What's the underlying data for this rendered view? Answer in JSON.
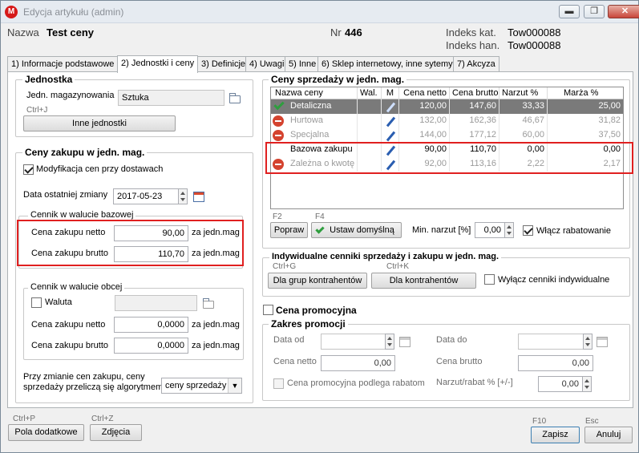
{
  "window": {
    "title": "Edycja artykułu (admin)",
    "minimize": "▬",
    "restore": "❐",
    "close": "✕",
    "app_icon": "M"
  },
  "header": {
    "name_label": "Nazwa",
    "name_value": "Test ceny",
    "nr_label": "Nr",
    "nr_value": "446",
    "indeks_kat_label": "Indeks kat.",
    "indeks_kat_value": "Tow000088",
    "indeks_han_label": "Indeks han.",
    "indeks_han_value": "Tow000088"
  },
  "tabs": [
    {
      "label": "1) Informacje podstawowe"
    },
    {
      "label": "2) Jednostki i ceny",
      "active": true
    },
    {
      "label": "3) Definicje"
    },
    {
      "label": "4) Uwagi"
    },
    {
      "label": "5) Inne"
    },
    {
      "label": "6) Sklep internetowy, inne sytemy"
    },
    {
      "label": "7) Akcyza"
    }
  ],
  "jednostka": {
    "title": "Jednostka",
    "label": "Jedn. magazynowania",
    "value": "Sztuka",
    "hint": "Ctrl+J",
    "other_units_button": "Inne jednostki"
  },
  "ceny_zakupu": {
    "title": "Ceny zakupu w jedn. mag.",
    "modyfikacja_label": "Modyfikacja cen przy dostawach",
    "modyfikacja_checked": true,
    "data_label": "Data ostatniej zmiany",
    "data_value": "2017-05-23",
    "bazowa": {
      "title": "Cennik w walucie bazowej",
      "netto_label": "Cena zakupu netto",
      "netto_value": "90,00",
      "brutto_label": "Cena zakupu brutto",
      "brutto_value": "110,70",
      "unit": "za jedn.mag"
    },
    "obca": {
      "title": "Cennik w walucie obcej",
      "waluta_label": "Waluta",
      "netto_label": "Cena zakupu netto",
      "netto_value": "0,0000",
      "brutto_label": "Cena zakupu brutto",
      "brutto_value": "0,0000",
      "unit": "za jedn.mag"
    },
    "algorytm_label_1": "Przy zmianie cen zakupu, ceny",
    "algorytm_label_2": "sprzedaży przeliczą się algorytmem",
    "algorytm_value": "ceny sprzedaży"
  },
  "ceny_sprzedazy": {
    "title": "Ceny sprzedaży w jedn. mag.",
    "columns": [
      "Nazwa ceny",
      "Wal.",
      "M",
      "Cena netto",
      "Cena brutto",
      "Narzut %",
      "Marża %"
    ],
    "rows": [
      {
        "icon": "check-icon",
        "name": "Detaliczna",
        "netto": "120,00",
        "brutto": "147,60",
        "narzut": "33,33",
        "marza": "25,00",
        "state": "selected"
      },
      {
        "icon": "minus-icon",
        "name": "Hurtowa",
        "netto": "132,00",
        "brutto": "162,36",
        "narzut": "46,67",
        "marza": "31,82",
        "state": "dim"
      },
      {
        "icon": "minus-icon",
        "name": "Specjalna",
        "netto": "144,00",
        "brutto": "177,12",
        "narzut": "60,00",
        "marza": "37,50",
        "state": "dim"
      },
      {
        "icon": "",
        "name": "Bazowa zakupu",
        "netto": "90,00",
        "brutto": "110,70",
        "narzut": "0,00",
        "marza": "0,00",
        "state": "normal"
      },
      {
        "icon": "minus-icon",
        "name": "Zależna o kwotę",
        "netto": "92,00",
        "brutto": "113,16",
        "narzut": "2,22",
        "marza": "2,17",
        "state": "dim"
      }
    ],
    "f2_hint": "F2",
    "f4_hint": "F4",
    "popraw_button": "Popraw",
    "ustaw_button": "Ustaw domyślną",
    "min_narzut_label": "Min. narzut [%]",
    "min_narzut_value": "0,00",
    "rabat_label": "Włącz rabatowanie",
    "rabat_checked": true
  },
  "indywidualne": {
    "title": "Indywidualne cenniki sprzedaży i zakupu w jedn. mag.",
    "hint_g": "Ctrl+G",
    "hint_k": "Ctrl+K",
    "grupy_button": "Dla grup kontrahentów",
    "kontrahenci_button": "Dla kontrahentów",
    "wylacz_label": "Wyłącz cenniki indywidualne"
  },
  "promocja": {
    "label": "Cena promocyjna",
    "zakres_title": "Zakres promocji",
    "data_od_label": "Data od",
    "data_do_label": "Data do",
    "cena_netto_label": "Cena netto",
    "cena_netto_value": "0,00",
    "cena_brutto_label": "Cena brutto",
    "cena_brutto_value": "0,00",
    "rabatem_label": "Cena promocyjna podlega rabatom",
    "narzut_label": "Narzut/rabat % [+/-]",
    "narzut_value": "0,00"
  },
  "footer": {
    "ctrlp_hint": "Ctrl+P",
    "ctrlz_hint": "Ctrl+Z",
    "f10_hint": "F10",
    "esc_hint": "Esc",
    "pola_button": "Pola dodatkowe",
    "zdjecia_button": "Zdjęcia",
    "zapisz_button": "Zapisz",
    "anuluj_button": "Anuluj"
  }
}
